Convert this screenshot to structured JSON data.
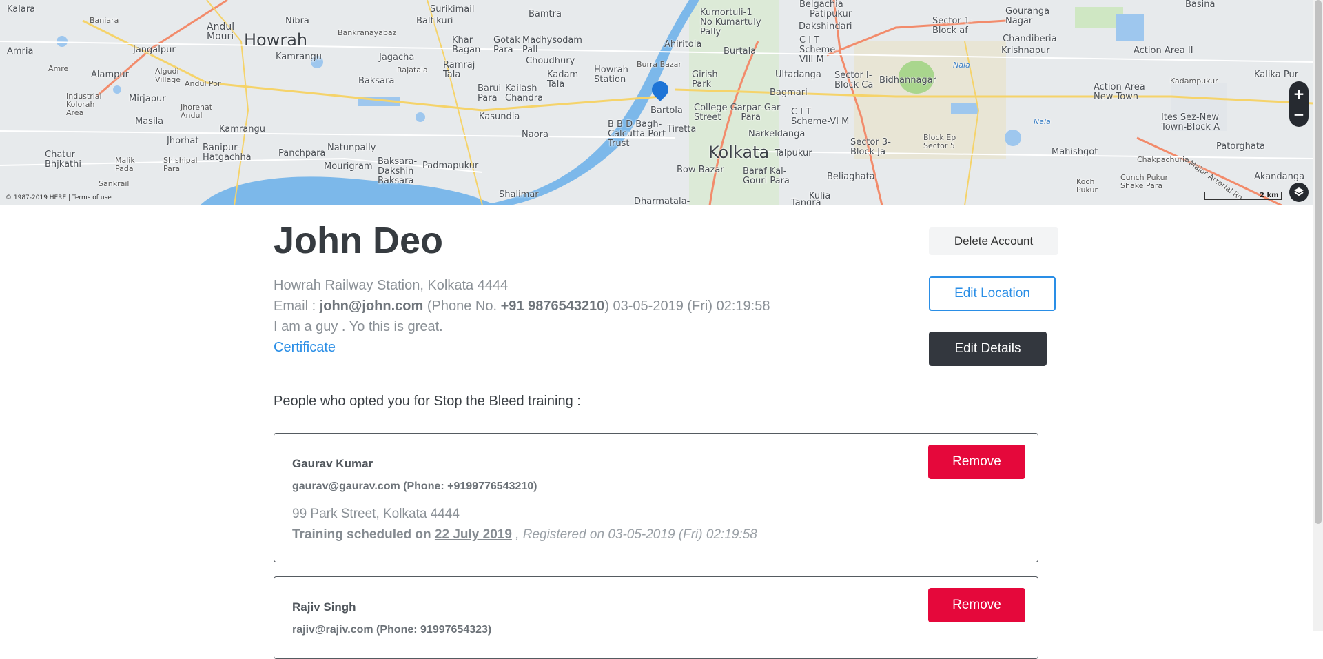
{
  "map": {
    "places": {
      "howrah": "Howrah",
      "kolkata": "Kolkata",
      "kalara": "Kalara",
      "baniara": "Baniara",
      "andul_mouri": "Andul\nMouri",
      "amrita": "Amria",
      "jangalpur": "Jangalpur",
      "alampur": "Alampur",
      "mirjapur": "Mirjapur",
      "masila": "Masila",
      "chatur_bhjkathi": "Chatur\nBhjkathi",
      "jhorhat": "Jhorhat",
      "kamrangu": "Kamrangu",
      "banipur": "Banipur-\nHatgachha",
      "panchpara": "Panchpara",
      "natunpally": "Natunpally",
      "mourigram": "Mourigram",
      "baksara": "Baksara-\nDakshin\nBaksara",
      "padmapukur": "Padmapukur",
      "shalimar": "Shalimar",
      "nibra": "Nibra",
      "surikimail": "Surikimail",
      "baltikuri": "Baltikuri",
      "bankranayabaz": "Bankranayabaz",
      "jagacha": "Jagacha",
      "kamrangu2": "Kamrangu",
      "khar_bagan": "Khar\nBagan",
      "gotak_para": "Gotak\nPara",
      "madhysodam_pali": "Madhysodam\nPall",
      "chaudhury": "Choudhury",
      "bamtra": "Bamtra",
      "ramraj_tala": "Ramraj\nTala",
      "baksara2": "Baksara",
      "barui_para": "Barui\nPara",
      "kailash_chandra": "Kailash\nChandra",
      "kadam_tala": "Kadam\nTala",
      "howrah_station": "Howrah\nStation",
      "kasundia": "Kasundia",
      "naora": "Naora",
      "bbd_bagh": "B B D Bagh-\nCalcutta Port\nTrust",
      "bartola": "Bartola",
      "tiretta": "Tiretta",
      "bow_bazar": "Bow Bazar",
      "burra_bazar": "Burra Bazar",
      "girish_park": "Girish\nPark",
      "ahiritola": "Ahiritola",
      "kumortuli": "Kumortuli-1\nNo Kumartuly\nPally",
      "burtala": "Burtala",
      "college_garpar": "College Garpar-Gar\nStreet       Para",
      "narkeldanga": "Narkeldanga",
      "bagmari": "Bagmari",
      "ultadanga": "Ultadanga",
      "talpukur": "Talpukur",
      "baraf_kal": "Baraf Kal-\nGouri Para",
      "beliaghata": "Beliaghata",
      "kulia": "Kulia",
      "cit_scheme_viii": "C I T\nScheme-\nVIII M",
      "cit_scheme_vi": "C I T\nScheme-VI M",
      "sector_i": "Sector I-\nBlock Ca",
      "sector_3": "Sector 3-\nBlock Ja",
      "bidhannagar": "Bidhannagar",
      "dakshindari": "Dakshindari",
      "patipukur": "Patipukur",
      "belgachia": "Belgachia",
      "sector_1_block_af": "Sector 1-\nBlock af",
      "gouranga_nagar": "Gouranga\nNagar",
      "chandiberia": "Chandiberia",
      "krishnapur": "Krishnapur",
      "action_area_ii": "Action Area II",
      "action_area_new_town": "Action Area\nNew Town",
      "mahishgot": "Mahishgot",
      "ites_sez": "Ites Sez-New\nTown-Block A",
      "basina": "Basina",
      "kalika_pur": "Kalika Pur",
      "kadampukur": "Kadampukur",
      "patorghata": "Patorghata",
      "akandanga": "Akandanga",
      "koch_pukur": "Koch\nPukur",
      "cunch_pukur": "Cunch Pukur\nShake Para",
      "chakpachuria": "Chakpachuria",
      "block_ep": "Block Ep\nSector 5",
      "dharmatala": "Dharmatala-",
      "tangra": "Tangra",
      "nala1": "Nala",
      "nala2": "Nala",
      "major_arterial": "Major Arterial Ro",
      "jhorehat_andul": "Jhorehat\nAndul",
      "malik_pada": "Malik\nPada",
      "shishipal_para": "Shishipal\nPara",
      "sankrail": "Sankrail",
      "industrial_kolorah": "Industrial\nKolorah\nArea",
      "algudi_village": "Algudi\nVillage",
      "andul_por": "Andul Por",
      "amre": "Amre",
      "rajatala": "Rajatala"
    },
    "scale_label": "2 km",
    "copyright": "© 1987-2019 HERE | Terms of use",
    "zoom_in": "+",
    "zoom_out": "−"
  },
  "profile": {
    "name": "John Deo",
    "address": "Howrah Railway Station, Kolkata 4444",
    "email_label": "Email : ",
    "email": "john@john.com",
    "phone_prefix": " (Phone No. ",
    "phone": "+91 9876543210",
    "phone_suffix": ") 03-05-2019 (Fri) 02:19:58",
    "bio": "I am a guy . Yo this is great.",
    "certificate_link": "Certificate"
  },
  "actions": {
    "delete_account": "Delete Account",
    "edit_location": "Edit Location",
    "edit_details": "Edit Details"
  },
  "section_title": "People who opted you for Stop the Bleed training :",
  "trainees": [
    {
      "name": "Gaurav Kumar",
      "contact": "gaurav@gaurav.com (Phone: +9199776543210)",
      "address": "99 Park Street, Kolkata 4444",
      "training_prefix": "Training scheduled on ",
      "training_date": "22 July 2019",
      "registered": " , Registered on 03-05-2019 (Fri) 02:19:58",
      "remove_label": "Remove"
    },
    {
      "name": "Rajiv Singh",
      "contact": "rajiv@rajiv.com (Phone: 91997654323)",
      "address": "",
      "training_prefix": "",
      "training_date": "",
      "registered": "",
      "remove_label": "Remove"
    }
  ]
}
